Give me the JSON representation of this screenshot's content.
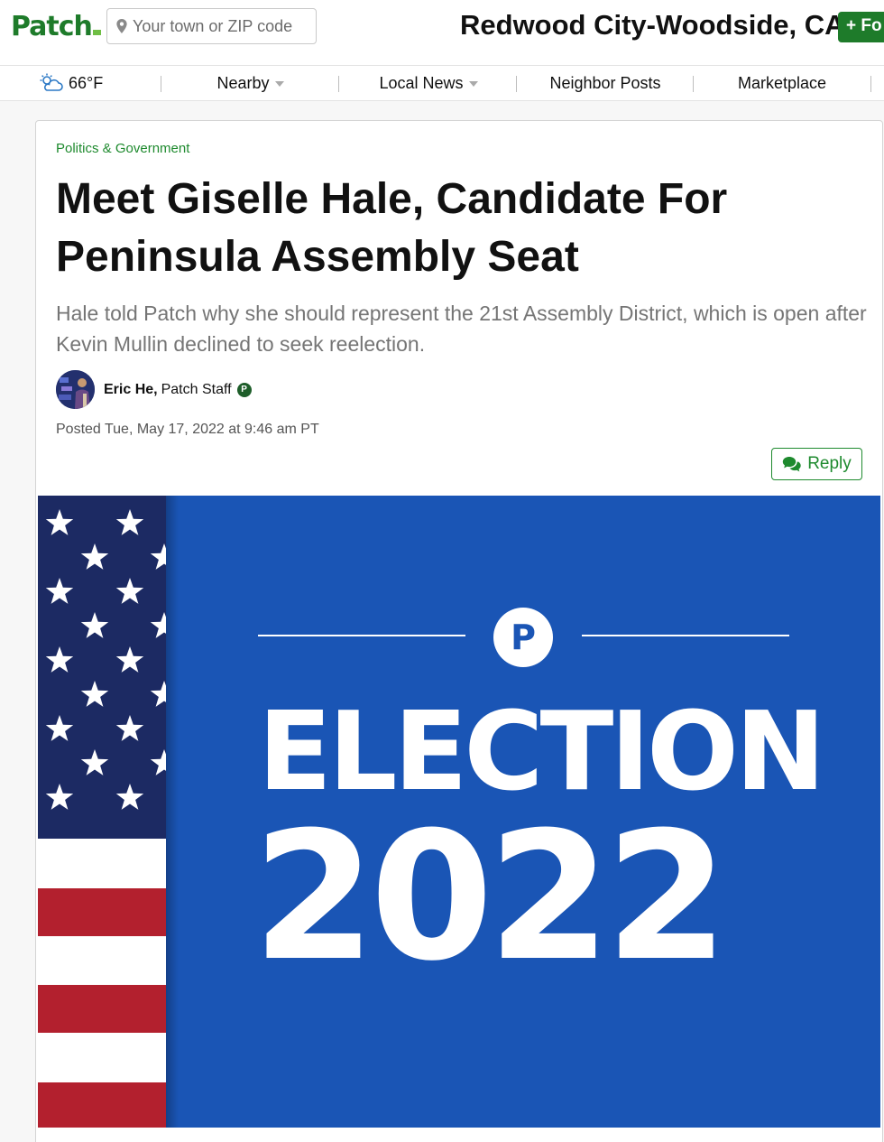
{
  "header": {
    "logo_text": "Patch",
    "search_placeholder": "Your town or ZIP code",
    "town": "Redwood City-Woodside, CA",
    "follow_label": "+ Fo",
    "brand_color": "#1e7b2a"
  },
  "nav": {
    "weather": "66°F",
    "weather_icon": "partly-cloudy-icon",
    "items": [
      {
        "label": "Nearby",
        "dropdown": true
      },
      {
        "label": "Local News",
        "dropdown": true
      },
      {
        "label": "Neighbor Posts",
        "dropdown": false
      },
      {
        "label": "Marketplace",
        "dropdown": false
      }
    ]
  },
  "article": {
    "category": "Politics & Government",
    "headline": "Meet Giselle Hale, Candidate For Peninsula Assembly Seat",
    "dek": "Hale told Patch why she should represent the 21st Assembly District, which is open after Kevin Mullin declined to seek reelection.",
    "author_name": "Eric He,",
    "author_role": "Patch Staff",
    "author_badge": "P",
    "posted": "Posted Tue, May 17, 2022 at 9:46 am PT",
    "reply_label": "Reply"
  },
  "hero": {
    "badge_letter": "P",
    "line1": "ELECTION",
    "line2": "2022",
    "background_color": "#1a55b5"
  }
}
